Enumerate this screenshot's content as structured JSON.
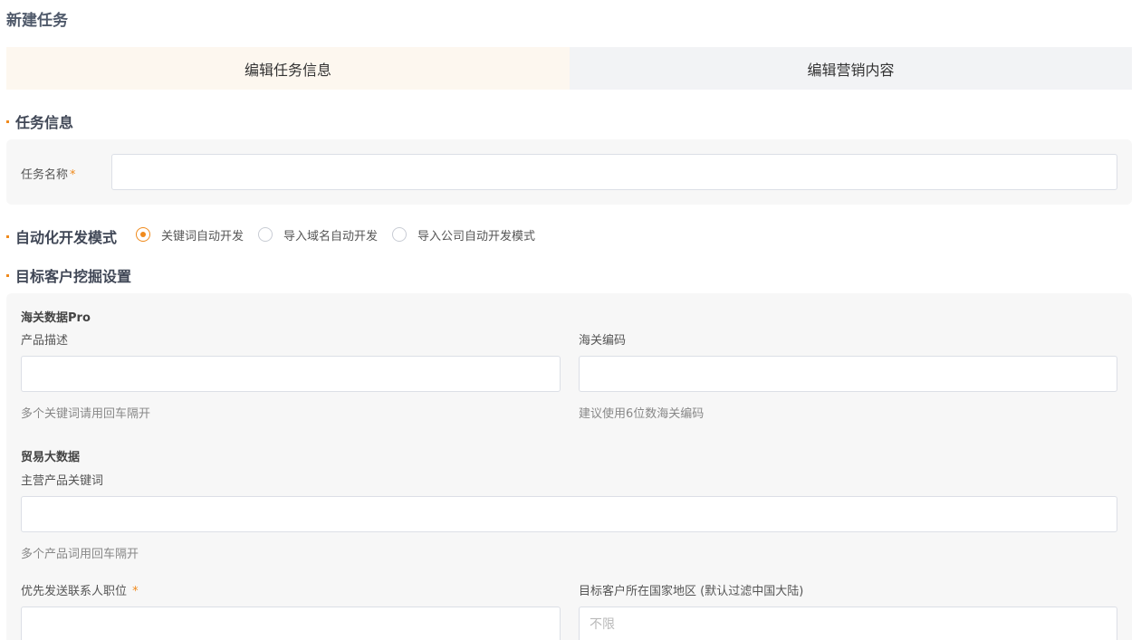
{
  "page": {
    "title": "新建任务"
  },
  "tabs": [
    {
      "label": "编辑任务信息",
      "active": true
    },
    {
      "label": "编辑营销内容",
      "active": false
    }
  ],
  "task_info": {
    "section_title": "任务信息",
    "name_label": "任务名称",
    "required_mark": "*",
    "name_value": ""
  },
  "dev_mode": {
    "section_title": "自动化开发模式",
    "options": [
      {
        "label": "关键词自动开发",
        "checked": true
      },
      {
        "label": "导入域名自动开发",
        "checked": false
      },
      {
        "label": "导入公司自动开发模式",
        "checked": false
      }
    ]
  },
  "target": {
    "section_title": "目标客户挖掘设置",
    "customs": {
      "title": "海关数据Pro",
      "product_desc_label": "产品描述",
      "product_desc_value": "",
      "product_desc_hint": "多个关键词请用回车隔开",
      "hs_code_label": "海关编码",
      "hs_code_value": "",
      "hs_code_hint": "建议使用6位数海关编码"
    },
    "trade": {
      "title": "贸易大数据",
      "keywords_label": "主营产品关键词",
      "keywords_value": "",
      "keywords_hint": "多个产品词用回车隔开"
    },
    "contact_position_label": "优先发送联系人职位",
    "contact_position_required": "*",
    "contact_position_value": "",
    "country_label": "目标客户所在国家地区 (默认过滤中国大陆)",
    "country_placeholder": "不限"
  },
  "colors": {
    "accent": "#f08a1c",
    "active_tab_bg": "#fdf7ef",
    "inactive_tab_bg": "#f2f3f5",
    "panel_bg": "#f7f7f7"
  }
}
